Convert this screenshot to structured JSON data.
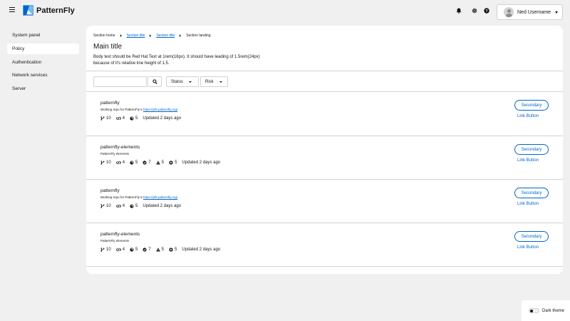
{
  "masthead": {
    "brand": "PatternFly",
    "user_name": "Ned Username"
  },
  "sidebar": {
    "items": [
      {
        "label": "System panel",
        "active": false
      },
      {
        "label": "Policy",
        "active": true
      },
      {
        "label": "Authentication",
        "active": false
      },
      {
        "label": "Network services",
        "active": false
      },
      {
        "label": "Server",
        "active": false
      }
    ]
  },
  "breadcrumb": [
    "Section home",
    "Section title",
    "Section title",
    "Section landing"
  ],
  "page": {
    "title": "Main title",
    "body": "Body text should be Red Hat Text at 1rem(16px). It should have leading of 1.5rem(24px) because of it's relative line height of 1.5."
  },
  "toolbar": {
    "search_placeholder": "",
    "status_label": "Status",
    "risk_label": "Risk"
  },
  "repos": [
    {
      "name": "patternfly",
      "desc": "Working repo for PatternFly 5",
      "link": "https://pf5.patternfly.org/",
      "branches": "10",
      "forks": "4",
      "prs": "5",
      "updated": "Updated 2 days ago"
    },
    {
      "name": "patternfly-elements",
      "desc": "PatternFly elements",
      "branches": "10",
      "forks": "4",
      "prs": "5",
      "checks": "7",
      "warnings": "5",
      "errors": "5",
      "updated": "Updated 2 days ago"
    },
    {
      "name": "patternfly",
      "desc": "Working repo for PatternFly 5",
      "link": "https://pf5.patternfly.org/",
      "branches": "10",
      "forks": "4",
      "prs": "5",
      "updated": "Updated 2 days ago"
    },
    {
      "name": "patternfly-elements",
      "desc": "PatternFly elements",
      "branches": "10",
      "forks": "4",
      "prs": "5",
      "checks": "7",
      "warnings": "5",
      "errors": "5",
      "updated": "Updated 2 days ago"
    }
  ],
  "actions": {
    "secondary_label": "Secondary",
    "link_label": "Link Button"
  },
  "theme": {
    "label": "Dark theme"
  },
  "colors": {
    "accent": "#0066cc",
    "page_bg": "#f0f0f0",
    "panel_bg": "#ffffff",
    "border": "#d2d2d2"
  },
  "icons": [
    "menu-icon",
    "logo-icon",
    "bell-icon",
    "gear-icon",
    "help-icon",
    "search-icon",
    "code-branch-icon",
    "code-fork-icon",
    "pull-request-icon",
    "check-circle-icon",
    "warning-icon",
    "error-circle-icon"
  ]
}
